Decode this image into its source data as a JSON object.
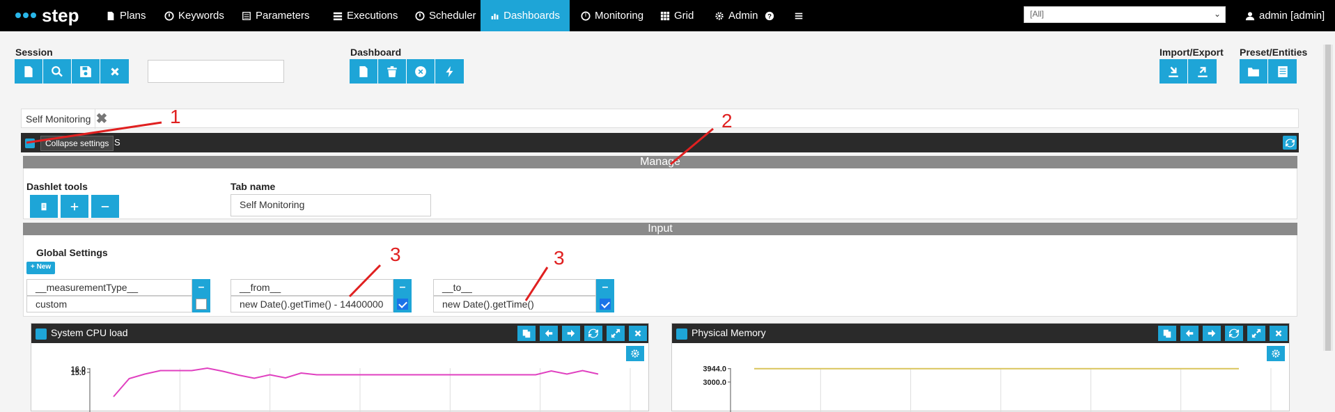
{
  "nav": {
    "brand": "step",
    "items": [
      {
        "label": "Plans",
        "icon": "file-icon"
      },
      {
        "label": "Keywords",
        "icon": "clock-icon"
      },
      {
        "label": "Parameters",
        "icon": "list-icon"
      },
      {
        "label": "Executions",
        "icon": "tasks-icon"
      },
      {
        "label": "Scheduler",
        "icon": "clock-icon"
      },
      {
        "label": "Dashboards",
        "icon": "bar-chart-icon",
        "active": true
      },
      {
        "label": "Monitoring",
        "icon": "dashboard-icon"
      },
      {
        "label": "Grid",
        "icon": "grid-icon"
      },
      {
        "label": "Admin",
        "icon": "gear-icon"
      }
    ],
    "help_icon": "question-circle-icon",
    "menu_icon": "hamburger-icon",
    "tenant_selected": "[All]",
    "user_label": "admin [admin]"
  },
  "toolbar": {
    "session_label": "Session",
    "session_input": "",
    "dashboard_label": "Dashboard",
    "import_export_label": "Import/Export",
    "preset_entities_label": "Preset/Entities"
  },
  "tabs": {
    "active_tab": "Self Monitoring"
  },
  "settings": {
    "tooltip": "Collapse settings",
    "title_tail": "S",
    "manage_header": "Manage",
    "dashlet_tools_label": "Dashlet tools",
    "tab_name_label": "Tab name",
    "tab_name_value": "Self Monitoring",
    "input_header": "Input",
    "global_settings_label": "Global Settings",
    "new_button": "+ New",
    "params": [
      {
        "key": "__measurementType__",
        "value": "custom",
        "checked": false
      },
      {
        "key": "__from__",
        "value": "new Date().getTime() - 14400000",
        "checked": true
      },
      {
        "key": "__to__",
        "value": "new Date().getTime()",
        "checked": true
      }
    ]
  },
  "dashlets": [
    {
      "title": "System CPU load",
      "y_ticks": [
        "16.0",
        "15.0"
      ]
    },
    {
      "title": "Physical Memory",
      "y_ticks": [
        "3944.0",
        "3000.0"
      ]
    }
  ],
  "annotations": [
    "1",
    "2",
    "3",
    "3"
  ],
  "colors": {
    "accent": "#1ea5d7",
    "nav_bg": "#000000",
    "cpu_series": "#e040c0",
    "memory_series": "#d9c45a",
    "annotation": "#e02020"
  },
  "chart_data": [
    {
      "type": "line",
      "title": "System CPU load",
      "y_tick_labels": [
        "16.0",
        "15.0"
      ],
      "series": [
        {
          "values": [
            8,
            13.2,
            14.5,
            15.5,
            15.5,
            15.5,
            16.2,
            15.3,
            14.2,
            13.3,
            14.3,
            13.4,
            14.8,
            14.3,
            14.3,
            14.3,
            14.3,
            14.3,
            14.3,
            14.3,
            14.3,
            14.3,
            14.3,
            14.3,
            14.3,
            14.3,
            14.3,
            14.3,
            15.4,
            14.5,
            15.5,
            14.5
          ]
        }
      ]
    },
    {
      "type": "line",
      "title": "Physical Memory",
      "y_tick_labels": [
        "3944.0",
        "3000.0"
      ],
      "series": [
        {
          "values": [
            3944,
            3944,
            3944,
            3944,
            3944,
            3944,
            3944,
            3944
          ]
        }
      ]
    }
  ]
}
